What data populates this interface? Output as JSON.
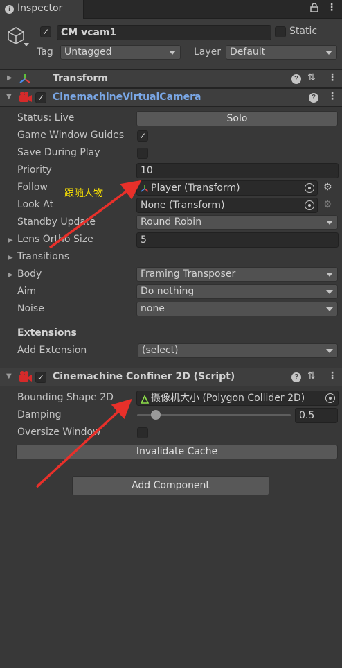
{
  "tab": {
    "label": "Inspector",
    "icon": "info-icon"
  },
  "object": {
    "name": "CM vcam1",
    "static_label": "Static",
    "tag_label": "Tag",
    "tag_value": "Untagged",
    "layer_label": "Layer",
    "layer_value": "Default"
  },
  "transform": {
    "title": "Transform"
  },
  "vcam": {
    "title": "CinemachineVirtualCamera",
    "status": "Status: Live",
    "solo": "Solo",
    "game_window_guides": "Game Window Guides",
    "save_during_play": "Save During Play",
    "priority_label": "Priority",
    "priority_value": "10",
    "follow_label": "Follow",
    "follow_value": "Player (Transform)",
    "lookat_label": "Look At",
    "lookat_value": "None (Transform)",
    "standby_label": "Standby Update",
    "standby_value": "Round Robin",
    "lens_label": "Lens Ortho Size",
    "lens_value": "5",
    "transitions_label": "Transitions",
    "body_label": "Body",
    "body_value": "Framing Transposer",
    "aim_label": "Aim",
    "aim_value": "Do nothing",
    "noise_label": "Noise",
    "noise_value": "none",
    "extensions_label": "Extensions",
    "add_extension_label": "Add Extension",
    "add_extension_value": "(select)"
  },
  "confiner": {
    "title": "Cinemachine Confiner 2D (Script)",
    "bounding_label": "Bounding Shape 2D",
    "bounding_value": "摄像机大小 (Polygon Collider 2D)",
    "damping_label": "Damping",
    "damping_value": "0.5",
    "damping_fraction": 0.12,
    "oversize_label": "Oversize Window",
    "invalidate": "Invalidate Cache"
  },
  "add_component": "Add Component",
  "annotation": {
    "text": "跟随人物",
    "color": "#ffe600",
    "arrow_color": "#e8302a"
  },
  "colors": {
    "accent_link": "#7aa7e6",
    "background": "#383838"
  }
}
